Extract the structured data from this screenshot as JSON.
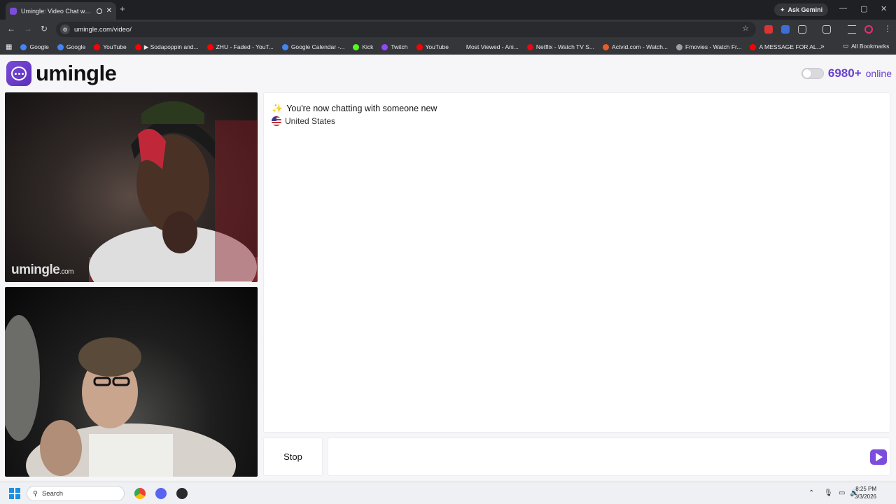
{
  "browser": {
    "tab_title": "Umingle: Video Chat with S",
    "url": "umingle.com/video/",
    "ask_gemini": "Ask Gemini",
    "bookmarks": [
      {
        "label": "Google",
        "color": "#4285f4"
      },
      {
        "label": "Google",
        "color": "#4285f4"
      },
      {
        "label": "YouTube",
        "color": "#ff0000"
      },
      {
        "label": "▶ Sodapoppin and...",
        "color": "#ff0000"
      },
      {
        "label": "ZHU - Faded - YouT...",
        "color": "#ff0000"
      },
      {
        "label": "Google Calendar -...",
        "color": "#4285f4"
      },
      {
        "label": "Kick",
        "color": "#53fc18"
      },
      {
        "label": "Twitch",
        "color": "#9146ff"
      },
      {
        "label": "YouTube",
        "color": "#ff0000"
      },
      {
        "label": "Most Viewed - Ani...",
        "color": "#35363a"
      },
      {
        "label": "Netflix - Watch TV S...",
        "color": "#e50914"
      },
      {
        "label": "Actvid.com - Watch...",
        "color": "#e85c26"
      },
      {
        "label": "Fmovies - Watch Fr...",
        "color": "#9aa0a6"
      },
      {
        "label": "A MESSAGE FOR AL...",
        "color": "#ff0000"
      }
    ],
    "all_bookmarks": "All Bookmarks"
  },
  "site": {
    "logo_text": "umingle",
    "online_count": "6980+",
    "online_label": "online",
    "brand_color": "#6a3fd1"
  },
  "video": {
    "watermark": "umingle",
    "watermark_suffix": ".com"
  },
  "chat": {
    "status": "You're now chatting with someone new",
    "country": "United States",
    "stop_label": "Stop",
    "message_placeholder": ""
  },
  "taskbar": {
    "search_label": "Search",
    "time": "8:25 PM",
    "date": "3/3/2026"
  }
}
